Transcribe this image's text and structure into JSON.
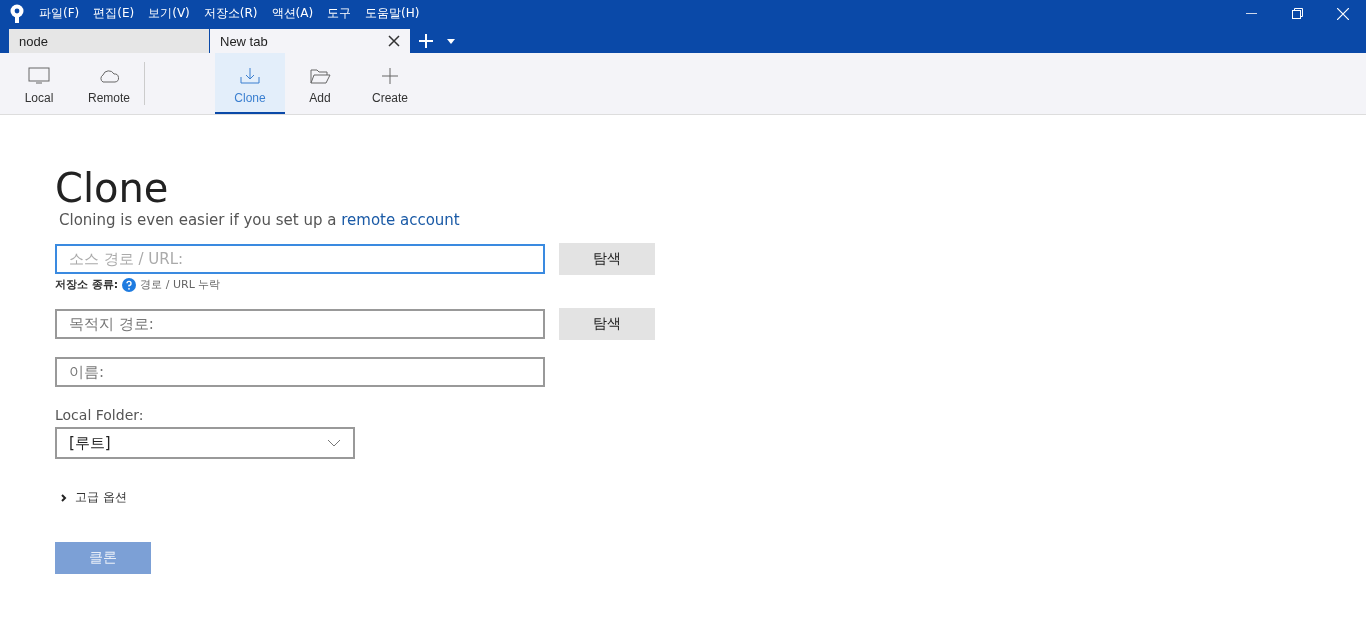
{
  "menu": [
    "파일(F)",
    "편집(E)",
    "보기(V)",
    "저장소(R)",
    "액션(A)",
    "도구",
    "도움말(H)"
  ],
  "tabs": [
    {
      "label": "node",
      "selected": false
    },
    {
      "label": "New tab",
      "selected": true
    }
  ],
  "toolbar": [
    {
      "label": "Local",
      "selected": false
    },
    {
      "label": "Remote",
      "selected": false
    },
    {
      "label": "Clone",
      "selected": true
    },
    {
      "label": "Add",
      "selected": false
    },
    {
      "label": "Create",
      "selected": false
    }
  ],
  "clone": {
    "title": "Clone",
    "subtitle": "Cloning is even easier if you set up a",
    "subtitle_link": "remote account",
    "source": {
      "placeholder": "소스 경로 / URL:",
      "focused": true,
      "button": "탐색"
    },
    "repo_type": {
      "label": "저장소 종류:",
      "status": "경로 / URL 누락"
    },
    "destination": {
      "placeholder": "목적지 경로:",
      "button": "탐색"
    },
    "name": {
      "placeholder": "이름:"
    },
    "local_folder": {
      "label": "Local Folder:",
      "value": "[루트]"
    },
    "advanced": {
      "label": "고급 옵션",
      "expanded": false
    },
    "clone_button": {
      "label": "클론",
      "disabled": true
    }
  }
}
